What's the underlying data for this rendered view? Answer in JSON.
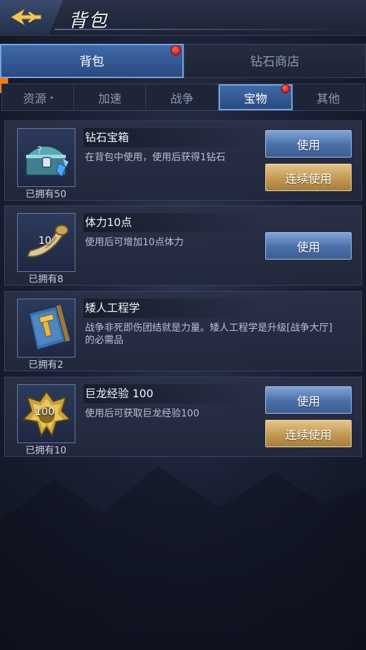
{
  "header": {
    "title": "背包",
    "back_icon": "back-arrow-icon"
  },
  "main_tabs": [
    {
      "label": "背包",
      "active": true,
      "badge": true
    },
    {
      "label": "钻石商店",
      "active": false,
      "badge": false
    }
  ],
  "sub_tabs": [
    {
      "label": "资源",
      "active": false,
      "badge": false
    },
    {
      "label": "加速",
      "active": false,
      "badge": false
    },
    {
      "label": "战争",
      "active": false,
      "badge": false
    },
    {
      "label": "宝物",
      "active": true,
      "badge": true
    },
    {
      "label": "其他",
      "active": false,
      "badge": false
    }
  ],
  "items": [
    {
      "name": "钻石宝箱",
      "desc": "在背包中使用，使用后获得1钻石",
      "owned": "已拥有50",
      "icon": "treasure-chest-icon",
      "use_label": "使用",
      "continuous_label": "连续使用"
    },
    {
      "name": "体力10点",
      "desc": "使用后可增加10点体力",
      "owned": "已拥有8",
      "icon": "horn-icon",
      "icon_number": "10",
      "use_label": "使用"
    },
    {
      "name": "矮人工程学",
      "desc": "战争非死即伤团结就是力量。矮人工程学是升级[战争大厅]的必需品",
      "owned": "已拥有2",
      "icon": "book-icon"
    },
    {
      "name": "巨龙经验 100",
      "desc": "使用后可获取巨龙经验100",
      "owned": "已拥有10",
      "icon": "dragon-emblem-icon",
      "icon_number": "100",
      "use_label": "使用",
      "continuous_label": "连续使用"
    }
  ],
  "colors": {
    "active_tab": "#3f6aa8",
    "use_button": "#4a6fa8",
    "continuous_button": "#c29852",
    "badge": "#d21f1f"
  }
}
